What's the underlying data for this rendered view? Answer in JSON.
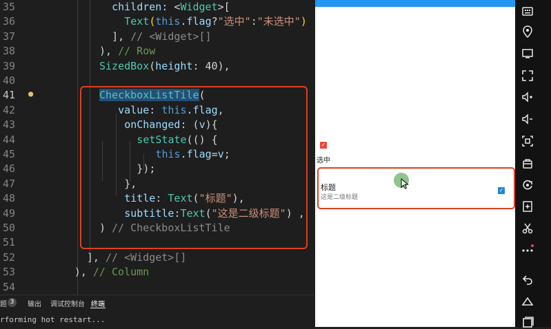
{
  "editor": {
    "line_numbers": [
      "35",
      "36",
      "37",
      "38",
      "39",
      "40",
      "41",
      "42",
      "43",
      "44",
      "45",
      "46",
      "47",
      "48",
      "49",
      "50",
      "51",
      "52",
      "53",
      "54"
    ],
    "lines": [
      [
        {
          "t": "children",
          "c": "tok-var"
        },
        {
          "t": ": <",
          "c": "tok-p"
        },
        {
          "t": "Widget",
          "c": "tok-type"
        },
        {
          "t": ">[",
          "c": "tok-p"
        }
      ],
      [
        {
          "t": "Text",
          "c": "tok-type"
        },
        {
          "t": "(",
          "c": "tok-br"
        },
        {
          "t": "this",
          "c": "tok-kw"
        },
        {
          "t": ".",
          "c": "tok-p"
        },
        {
          "t": "flag",
          "c": "tok-var"
        },
        {
          "t": "?",
          "c": "tok-p"
        },
        {
          "t": "\"选中\"",
          "c": "tok-str"
        },
        {
          "t": ":",
          "c": "tok-p"
        },
        {
          "t": "\"未选中\"",
          "c": "tok-str"
        },
        {
          "t": ")",
          "c": "tok-br"
        }
      ],
      [
        {
          "t": "], ",
          "c": "tok-p"
        },
        {
          "t": "// <Widget>[]",
          "c": "tok-cmtg"
        }
      ],
      [
        {
          "t": "), ",
          "c": "tok-p"
        },
        {
          "t": "// Row",
          "c": "tok-cmt"
        }
      ],
      [
        {
          "t": "SizedBox",
          "c": "tok-type"
        },
        {
          "t": "(",
          "c": "tok-p"
        },
        {
          "t": "height",
          "c": "tok-var"
        },
        {
          "t": ": 40),",
          "c": "tok-p"
        }
      ],
      [],
      [
        {
          "t": "CheckboxListTile",
          "c": "tok-type tok-hl"
        },
        {
          "t": "(",
          "c": "tok-p"
        }
      ],
      [
        {
          "t": "value",
          "c": "tok-var"
        },
        {
          "t": ": ",
          "c": "tok-p"
        },
        {
          "t": "this",
          "c": "tok-kw"
        },
        {
          "t": ".",
          "c": "tok-p"
        },
        {
          "t": "flag",
          "c": "tok-var"
        },
        {
          "t": ",",
          "c": "tok-p"
        }
      ],
      [
        {
          "t": "onChanged",
          "c": "tok-var"
        },
        {
          "t": ": (",
          "c": "tok-p"
        },
        {
          "t": "v",
          "c": "tok-var"
        },
        {
          "t": "){",
          "c": "tok-p"
        }
      ],
      [
        {
          "t": "setState",
          "c": "tok-type"
        },
        {
          "t": "(() {",
          "c": "tok-p"
        }
      ],
      [
        {
          "t": "this",
          "c": "tok-kw"
        },
        {
          "t": ".",
          "c": "tok-p"
        },
        {
          "t": "flag",
          "c": "tok-var"
        },
        {
          "t": "=",
          "c": "tok-p"
        },
        {
          "t": "v",
          "c": "tok-var"
        },
        {
          "t": ";",
          "c": "tok-p"
        }
      ],
      [
        {
          "t": "});",
          "c": "tok-p"
        }
      ],
      [
        {
          "t": "},",
          "c": "tok-p"
        }
      ],
      [
        {
          "t": "title",
          "c": "tok-var"
        },
        {
          "t": ": ",
          "c": "tok-p"
        },
        {
          "t": "Text",
          "c": "tok-type"
        },
        {
          "t": "(",
          "c": "tok-p"
        },
        {
          "t": "\"标题\"",
          "c": "tok-str"
        },
        {
          "t": "),",
          "c": "tok-p"
        }
      ],
      [
        {
          "t": "subtitle",
          "c": "tok-var"
        },
        {
          "t": ":",
          "c": "tok-p"
        },
        {
          "t": "Text",
          "c": "tok-type"
        },
        {
          "t": "(",
          "c": "tok-p"
        },
        {
          "t": "\"这是二级标题\"",
          "c": "tok-str"
        },
        {
          "t": ") ,",
          "c": "tok-p"
        }
      ],
      [
        {
          "t": ") ",
          "c": "tok-p"
        },
        {
          "t": "// CheckboxListTile",
          "c": "tok-cmtg"
        }
      ],
      [],
      [
        {
          "t": "], ",
          "c": "tok-p"
        },
        {
          "t": "// <Widget>[]",
          "c": "tok-cmtg"
        }
      ],
      [
        {
          "t": "), ",
          "c": "tok-p"
        },
        {
          "t": "// Column",
          "c": "tok-cmt"
        }
      ],
      []
    ]
  },
  "panel": {
    "tabs": [
      {
        "label": "题"
      },
      {
        "label": "3"
      },
      {
        "label": "输出"
      },
      {
        "label": "调试控制台"
      },
      {
        "label": "终端"
      }
    ],
    "active_tab": "终端",
    "terminal_text": "rforming hot restart..."
  },
  "app": {
    "checkbox_checked": true,
    "flag_text": "选中",
    "tile": {
      "title": "标题",
      "subtitle": "这是二级标题",
      "checked": true
    },
    "colors": {
      "app_bar": "#2196f3",
      "checkbox_small": "#e9473d",
      "tile_checkbox": "#1f86d9",
      "highlight_border": "#e0401f"
    }
  },
  "toolbar": {
    "icons": [
      "keyboard-icon",
      "location-icon",
      "screen-icon",
      "fullscreen-icon",
      "volume-up-icon",
      "volume-down-icon",
      "screenshot-icon",
      "bag-icon",
      "rotate-icon",
      "add-screen-icon",
      "scissors-icon",
      "more-icon",
      "back-icon",
      "home-icon",
      "recents-icon"
    ]
  }
}
